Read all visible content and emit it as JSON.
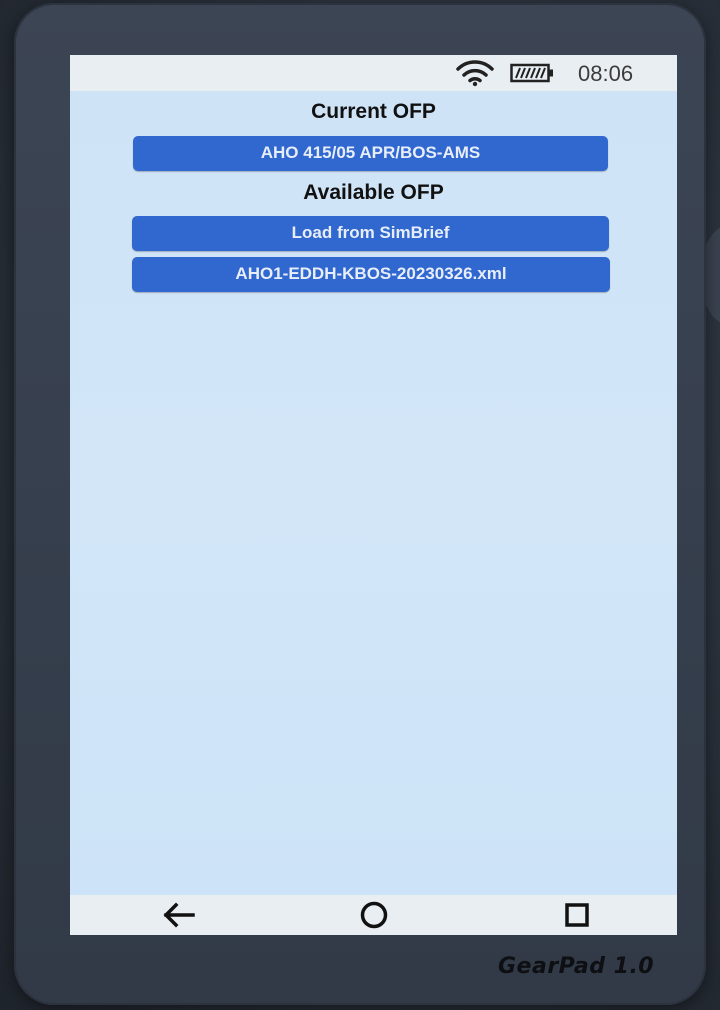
{
  "status_bar": {
    "time": "08:06",
    "wifi_icon": "wifi-icon",
    "battery_icon": "battery-icon"
  },
  "current_ofp": {
    "heading": "Current OFP",
    "flight_button": "AHO 415/05 APR/BOS-AMS"
  },
  "available_ofp": {
    "heading": "Available OFP",
    "items": [
      "Load from SimBrief",
      "AHO1-EDDH-KBOS-20230326.xml"
    ]
  },
  "nav_bar": {
    "back_icon": "back-arrow-icon",
    "home_icon": "home-circle-icon",
    "recents_icon": "recents-square-icon"
  },
  "device": {
    "brand": "GearPad 1.0"
  },
  "colors": {
    "button_bg": "#3168cf",
    "screen_bg": "#d3e6f7",
    "bezel": "#3a4352"
  }
}
